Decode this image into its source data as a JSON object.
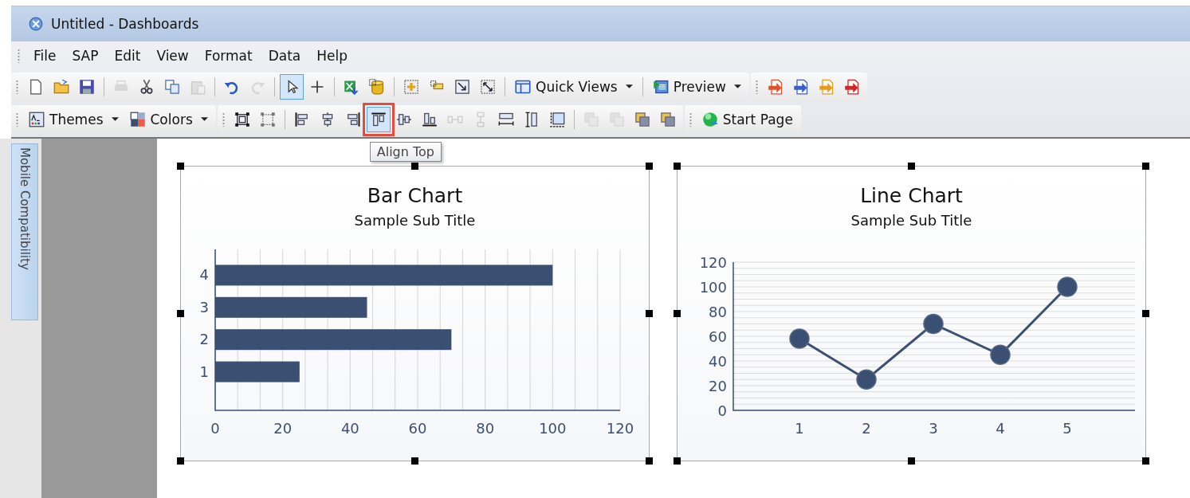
{
  "window": {
    "title": "Untitled - Dashboards"
  },
  "menu": [
    {
      "label": "File"
    },
    {
      "label": "SAP"
    },
    {
      "label": "Edit"
    },
    {
      "label": "View"
    },
    {
      "label": "Format"
    },
    {
      "label": "Data"
    },
    {
      "label": "Help"
    }
  ],
  "toolbars": [
    {
      "groups": [
        {
          "items": [
            {
              "kind": "icon",
              "selected": false,
              "disabled": false
            },
            {
              "kind": "icon",
              "selected": false,
              "disabled": false
            },
            {
              "kind": "icon",
              "selected": false,
              "disabled": false
            },
            {
              "kind": "separator"
            },
            {
              "kind": "icon",
              "selected": false,
              "disabled": true
            },
            {
              "kind": "icon",
              "selected": false,
              "disabled": false
            },
            {
              "kind": "icon",
              "selected": false,
              "disabled": false
            },
            {
              "kind": "icon",
              "selected": false,
              "disabled": true
            },
            {
              "kind": "separator"
            },
            {
              "kind": "icon",
              "selected": false,
              "disabled": false
            },
            {
              "kind": "icon",
              "selected": false,
              "disabled": true
            },
            {
              "kind": "separator"
            },
            {
              "kind": "icon",
              "selected": true,
              "disabled": false
            },
            {
              "kind": "icon",
              "selected": false,
              "disabled": false
            },
            {
              "kind": "separator"
            },
            {
              "kind": "icon",
              "selected": false,
              "disabled": false
            },
            {
              "kind": "icon",
              "selected": false,
              "disabled": false
            },
            {
              "kind": "separator"
            },
            {
              "kind": "icon",
              "selected": false,
              "disabled": false
            },
            {
              "kind": "icon",
              "selected": false,
              "disabled": false
            },
            {
              "kind": "icon",
              "selected": false,
              "disabled": false
            },
            {
              "kind": "icon",
              "selected": false,
              "disabled": false
            },
            {
              "kind": "separator"
            },
            {
              "kind": "menu",
              "label": "Quick Views",
              "dropdown": true
            },
            {
              "kind": "separator"
            },
            {
              "kind": "menu",
              "label": "Preview",
              "dropdown": true
            }
          ]
        },
        {
          "items": [
            {
              "kind": "icon",
              "selected": false,
              "disabled": false
            },
            {
              "kind": "icon",
              "selected": false,
              "disabled": false
            },
            {
              "kind": "icon",
              "selected": false,
              "disabled": false
            },
            {
              "kind": "icon",
              "selected": false,
              "disabled": false
            }
          ]
        }
      ]
    },
    {
      "groups": [
        {
          "items": [
            {
              "kind": "menu",
              "label": "Themes",
              "dropdown": true
            },
            {
              "kind": "menu",
              "label": "Colors",
              "dropdown": true
            }
          ]
        },
        {
          "items": [
            {
              "kind": "icon",
              "selected": false,
              "disabled": false
            },
            {
              "kind": "icon",
              "selected": false,
              "disabled": false
            },
            {
              "kind": "separator"
            },
            {
              "kind": "icon",
              "selected": false,
              "disabled": false
            },
            {
              "kind": "icon",
              "selected": false,
              "disabled": false
            },
            {
              "kind": "icon",
              "selected": false,
              "disabled": false
            },
            {
              "kind": "icon",
              "selected": true,
              "disabled": false,
              "highlighted": true,
              "tooltip": "Align Top"
            },
            {
              "kind": "icon",
              "selected": false,
              "disabled": false
            },
            {
              "kind": "icon",
              "selected": false,
              "disabled": false
            },
            {
              "kind": "icon",
              "selected": false,
              "disabled": true
            },
            {
              "kind": "icon",
              "selected": false,
              "disabled": true
            },
            {
              "kind": "icon",
              "selected": false,
              "disabled": false
            },
            {
              "kind": "icon",
              "selected": false,
              "disabled": false
            },
            {
              "kind": "icon",
              "selected": false,
              "disabled": false
            },
            {
              "kind": "separator"
            },
            {
              "kind": "icon",
              "selected": false,
              "disabled": true
            },
            {
              "kind": "icon",
              "selected": false,
              "disabled": true
            },
            {
              "kind": "icon",
              "selected": false,
              "disabled": false
            },
            {
              "kind": "icon",
              "selected": false,
              "disabled": false
            }
          ]
        },
        {
          "items": [
            {
              "kind": "menu",
              "label": "Start Page",
              "dropdown": false
            }
          ]
        }
      ]
    }
  ],
  "side_tab": {
    "label": "Mobile Compatibility"
  },
  "charts": [
    {
      "title": "Bar Chart",
      "subtitle": "Sample Sub Title",
      "chart_data": {
        "type": "bar",
        "orientation": "horizontal",
        "categories": [
          "4",
          "3",
          "2",
          "1"
        ],
        "values": [
          100,
          45,
          70,
          25
        ],
        "xlim": [
          0,
          120
        ],
        "xticks": [
          0,
          20,
          40,
          60,
          80,
          100,
          120
        ],
        "grid": true
      }
    },
    {
      "title": "Line Chart",
      "subtitle": "Sample Sub Title",
      "chart_data": {
        "type": "line",
        "categories": [
          "1",
          "2",
          "3",
          "4",
          "5"
        ],
        "values": [
          58,
          25,
          70,
          45,
          100
        ],
        "ylim": [
          0,
          120
        ],
        "yticks": [
          0,
          20,
          40,
          60,
          80,
          100,
          120
        ],
        "grid": true,
        "marker": true
      }
    }
  ]
}
